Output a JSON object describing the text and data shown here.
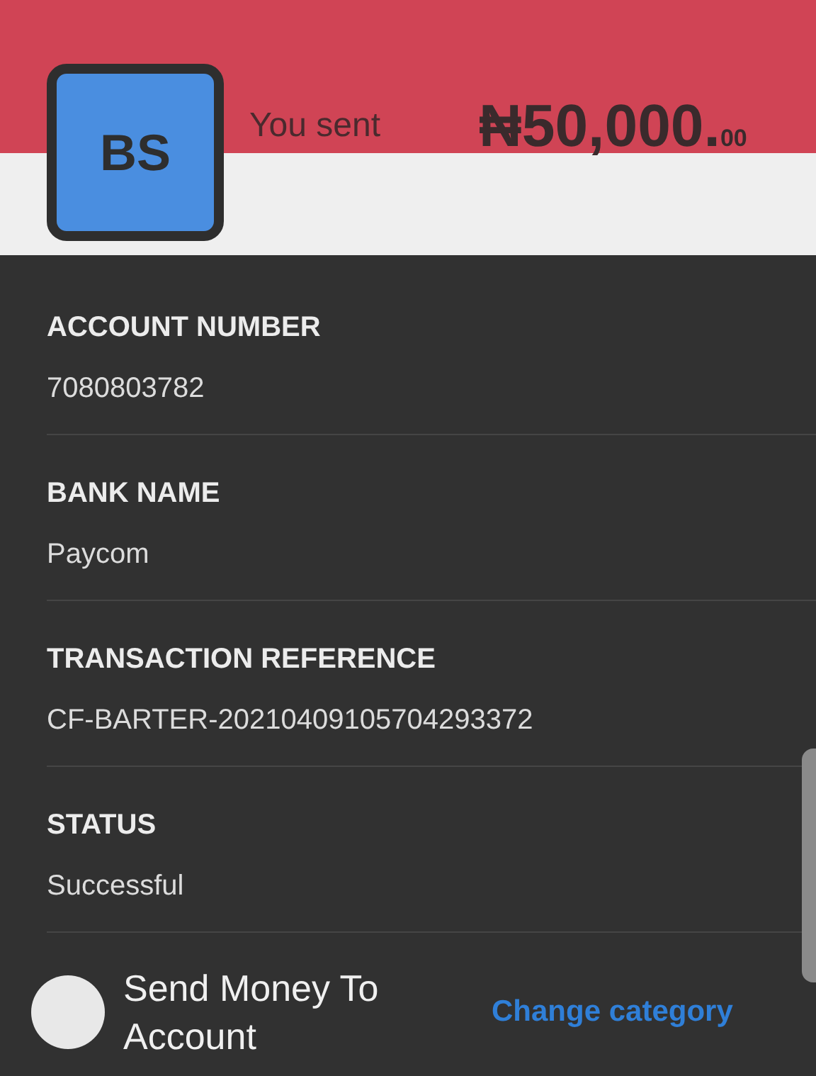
{
  "header": {
    "initials": "BS",
    "caption": "You sent",
    "amount": "₦50,000.$_{00}$"
  },
  "details": [
    {
      "label": "ACCOUNT NUMBER",
      "value": "7080803782"
    },
    {
      "label": "BANK NAME",
      "value": "Paycom"
    },
    {
      "label": "TRANSACTION REFERENCE",
      "value": "CF-BARTER-20210409105704293372"
    },
    {
      "label": "STATUS",
      "value": "Successful"
    }
  ],
  "category": {
    "name": "Send Money To Account",
    "action": "Change category"
  }
}
